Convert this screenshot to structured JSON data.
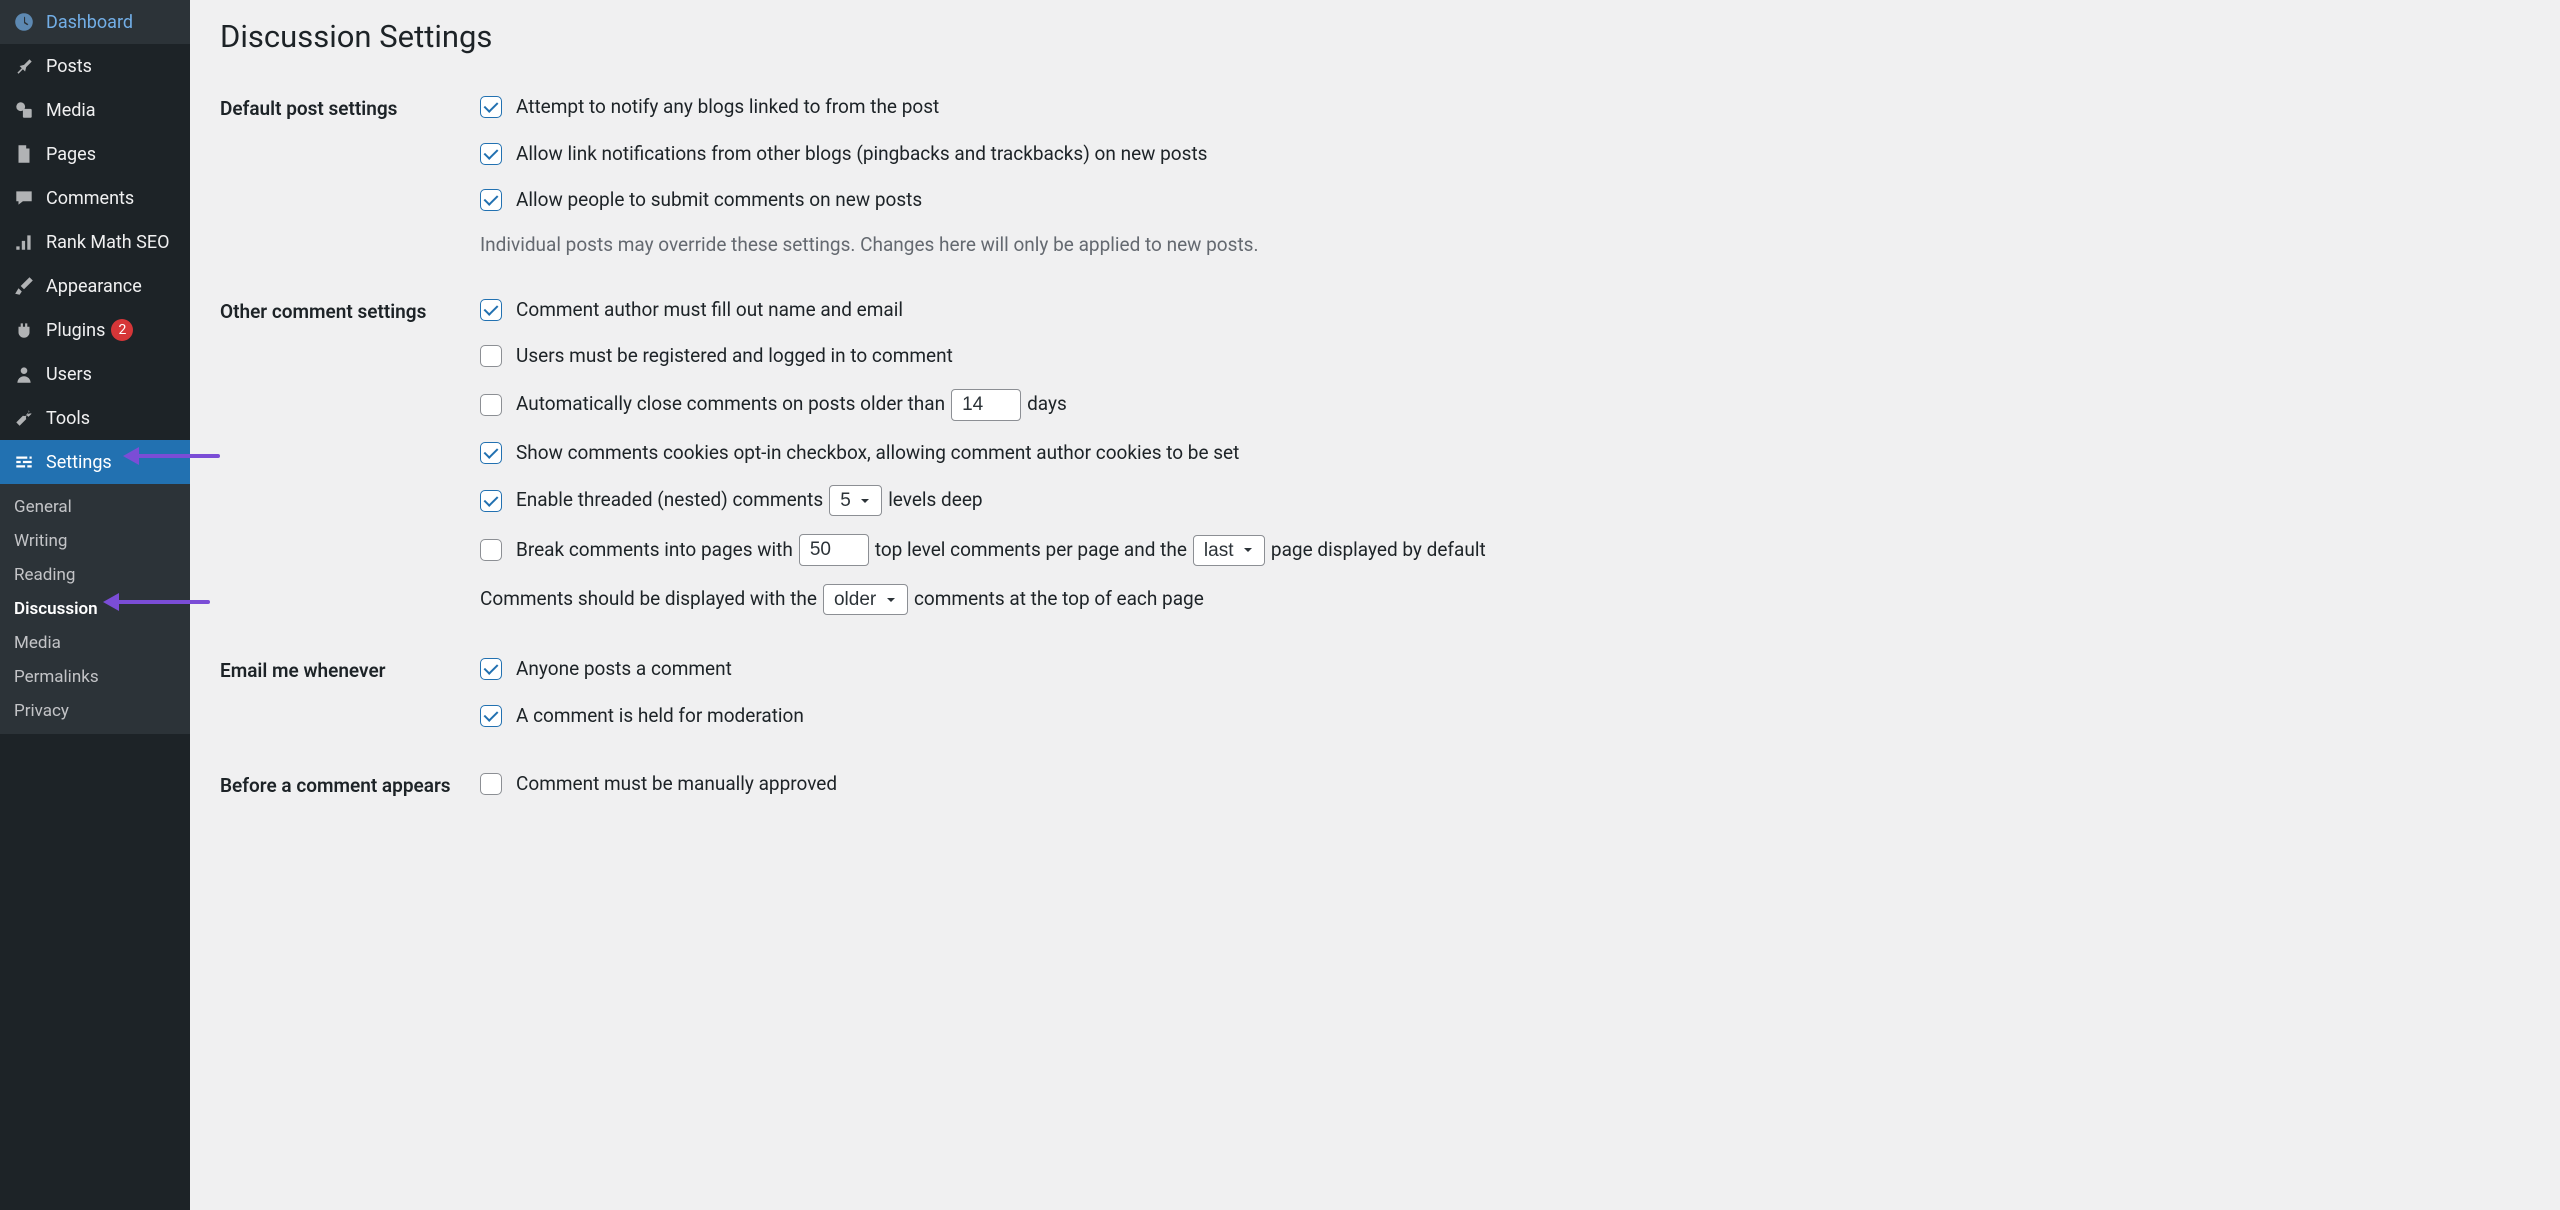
{
  "page": {
    "title": "Discussion Settings"
  },
  "sidebar": {
    "items": [
      {
        "label": "Dashboard"
      },
      {
        "label": "Posts"
      },
      {
        "label": "Media"
      },
      {
        "label": "Pages"
      },
      {
        "label": "Comments"
      },
      {
        "label": "Rank Math SEO"
      },
      {
        "label": "Appearance"
      },
      {
        "label": "Plugins",
        "badge": "2"
      },
      {
        "label": "Users"
      },
      {
        "label": "Tools"
      },
      {
        "label": "Settings"
      }
    ],
    "subitems": [
      {
        "label": "General"
      },
      {
        "label": "Writing"
      },
      {
        "label": "Reading"
      },
      {
        "label": "Discussion"
      },
      {
        "label": "Media"
      },
      {
        "label": "Permalinks"
      },
      {
        "label": "Privacy"
      }
    ]
  },
  "sections": {
    "default_post": {
      "title": "Default post settings",
      "notify_blogs": "Attempt to notify any blogs linked to from the post",
      "allow_pingbacks": "Allow link notifications from other blogs (pingbacks and trackbacks) on new posts",
      "allow_comments": "Allow people to submit comments on new posts",
      "note": "Individual posts may override these settings. Changes here will only be applied to new posts."
    },
    "other_comment": {
      "title": "Other comment settings",
      "must_name_email": "Comment author must fill out name and email",
      "must_registered": "Users must be registered and logged in to comment",
      "autoclose_prefix": "Automatically close comments on posts older than",
      "autoclose_value": "14",
      "autoclose_suffix": "days",
      "cookies_opt": "Show comments cookies opt-in checkbox, allowing comment author cookies to be set",
      "threaded_prefix": "Enable threaded (nested) comments",
      "threaded_value": "5",
      "threaded_suffix": "levels deep",
      "break_pages_prefix": "Break comments into pages with",
      "break_pages_value": "50",
      "break_pages_mid": "top level comments per page and the",
      "break_pages_select": "last",
      "break_pages_suffix": "page displayed by default",
      "display_prefix": "Comments should be displayed with the",
      "display_select": "older",
      "display_suffix": "comments at the top of each page"
    },
    "email_me": {
      "title": "Email me whenever",
      "anyone_posts": "Anyone posts a comment",
      "held_moderation": "A comment is held for moderation"
    },
    "before_appears": {
      "title": "Before a comment appears",
      "manual_approve": "Comment must be manually approved"
    }
  }
}
